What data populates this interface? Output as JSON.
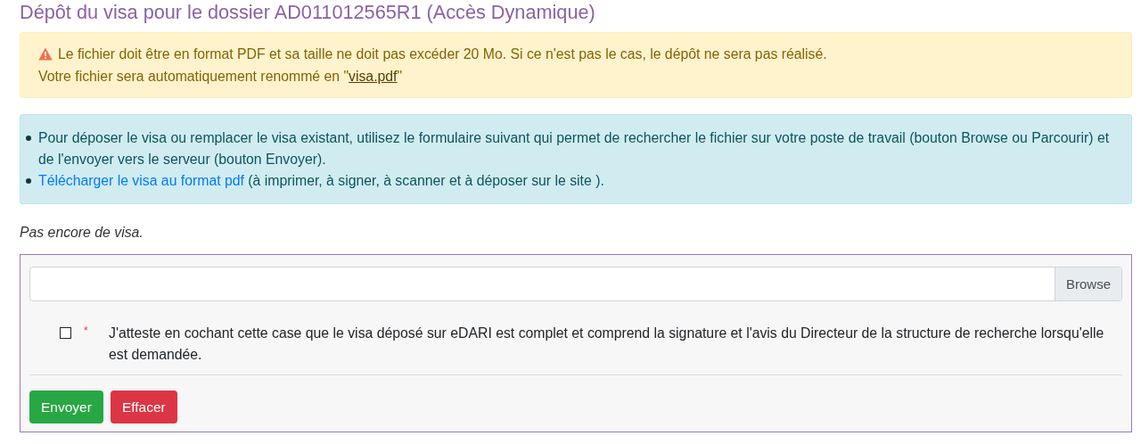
{
  "page_title": "Dépôt du visa pour le dossier AD011012565R1 (Accès Dynamique)",
  "warning": {
    "line_1": "Le fichier doit être en format PDF et sa taille ne doit pas excéder 20 Mo. Si ce n'est pas le cas, le dépôt ne sera pas réalisé.",
    "line_2_start": "Votre fichier sera automatiquement renommé en \"",
    "file_link": "visa.pdf",
    "line_2_end": "\""
  },
  "info_items": [
    {
      "kind": "text",
      "text": "Pour déposer le visa ou remplacer le visa existant, utilisez le formulaire suivant qui permet de rechercher le fichier sur votre poste de travail (bouton Browse ou Parcourir) et de l'envoyer vers le serveur (bouton Envoyer)."
    },
    {
      "kind": "link",
      "link": "Télécharger le visa au format pdf",
      "text": "(à imprimer, à signer, à scanner et à déposer sur le site )."
    }
  ],
  "status_text": "Pas encore de visa.",
  "form": {
    "browse_button": "Browse",
    "attestation": {
      "checked": false,
      "required": true,
      "required_mark": "*",
      "label": "J'atteste en cochant cette case que le visa déposé sur eDARI est complet et comprend la signature et l'avis du Directeur de la structure de recherche lorsqu'elle est demandée."
    },
    "buttons": [
      {
        "kind": "submit",
        "label": "Envoyer"
      },
      {
        "kind": "reset",
        "label": "Effacer"
      }
    ]
  }
}
